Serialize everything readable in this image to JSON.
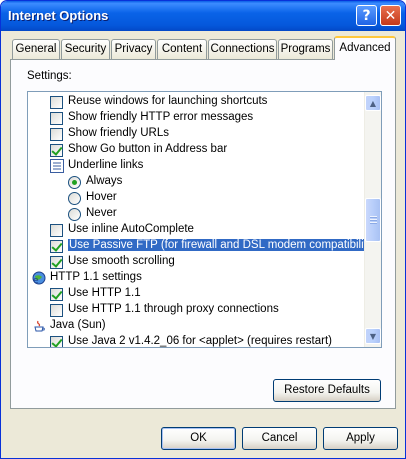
{
  "window": {
    "title": "Internet Options",
    "help_glyph": "?",
    "close_glyph": "✕"
  },
  "tabs": [
    {
      "label": "General"
    },
    {
      "label": "Security"
    },
    {
      "label": "Privacy"
    },
    {
      "label": "Content"
    },
    {
      "label": "Connections"
    },
    {
      "label": "Programs"
    },
    {
      "label": "Advanced",
      "active": true
    }
  ],
  "settings": {
    "label": "Settings:",
    "scroll_position_percent": 50,
    "items": [
      {
        "type": "checkbox",
        "indent": 1,
        "checked": false,
        "label": "Reuse windows for launching shortcuts"
      },
      {
        "type": "checkbox",
        "indent": 1,
        "checked": false,
        "label": "Show friendly HTTP error messages"
      },
      {
        "type": "checkbox",
        "indent": 1,
        "checked": false,
        "label": "Show friendly URLs"
      },
      {
        "type": "checkbox",
        "indent": 1,
        "checked": true,
        "label": "Show Go button in Address bar"
      },
      {
        "type": "group",
        "indent": 1,
        "icon": "underline-group-icon",
        "label": "Underline links"
      },
      {
        "type": "radio",
        "indent": 2,
        "checked": true,
        "label": "Always"
      },
      {
        "type": "radio",
        "indent": 2,
        "checked": false,
        "label": "Hover"
      },
      {
        "type": "radio",
        "indent": 2,
        "checked": false,
        "label": "Never"
      },
      {
        "type": "checkbox",
        "indent": 1,
        "checked": false,
        "label": "Use inline AutoComplete"
      },
      {
        "type": "checkbox",
        "indent": 1,
        "checked": true,
        "selected": true,
        "label": "Use Passive FTP (for firewall and DSL modem compatibility)"
      },
      {
        "type": "checkbox",
        "indent": 1,
        "checked": true,
        "label": "Use smooth scrolling"
      },
      {
        "type": "group",
        "indent": 0,
        "icon": "globe-icon",
        "label": "HTTP 1.1 settings"
      },
      {
        "type": "checkbox",
        "indent": 1,
        "checked": true,
        "label": "Use HTTP 1.1"
      },
      {
        "type": "checkbox",
        "indent": 1,
        "checked": false,
        "label": "Use HTTP 1.1 through proxy connections"
      },
      {
        "type": "group",
        "indent": 0,
        "icon": "java-cup-icon",
        "label": "Java (Sun)"
      },
      {
        "type": "checkbox",
        "indent": 1,
        "checked": true,
        "label": "Use Java 2 v1.4.2_06 for <applet> (requires restart)"
      }
    ]
  },
  "buttons": {
    "restore_defaults": "Restore Defaults",
    "ok": "OK",
    "cancel": "Cancel",
    "apply": "Apply"
  },
  "colors": {
    "selection": "#316ac5",
    "check": "#21a121",
    "titlebar": "#0a63e8",
    "active_tab_accent": "#ffc83c"
  }
}
